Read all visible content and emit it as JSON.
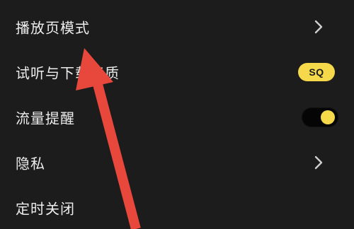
{
  "settings": {
    "items": [
      {
        "label": "播放页模式",
        "trailing": "chevron"
      },
      {
        "label": "试听与下载音质",
        "trailing": "badge",
        "badge_text": "SQ"
      },
      {
        "label": "流量提醒",
        "trailing": "toggle",
        "toggle_on": true
      },
      {
        "label": "隐私",
        "trailing": "chevron"
      },
      {
        "label": "定时关闭",
        "trailing": "none"
      }
    ]
  },
  "colors": {
    "background": "#1c1c1c",
    "text": "#ededed",
    "accent_yellow": "#f5d94b",
    "annotation_arrow": "#e8473b"
  },
  "annotation": {
    "icon": "red-arrow-icon"
  }
}
